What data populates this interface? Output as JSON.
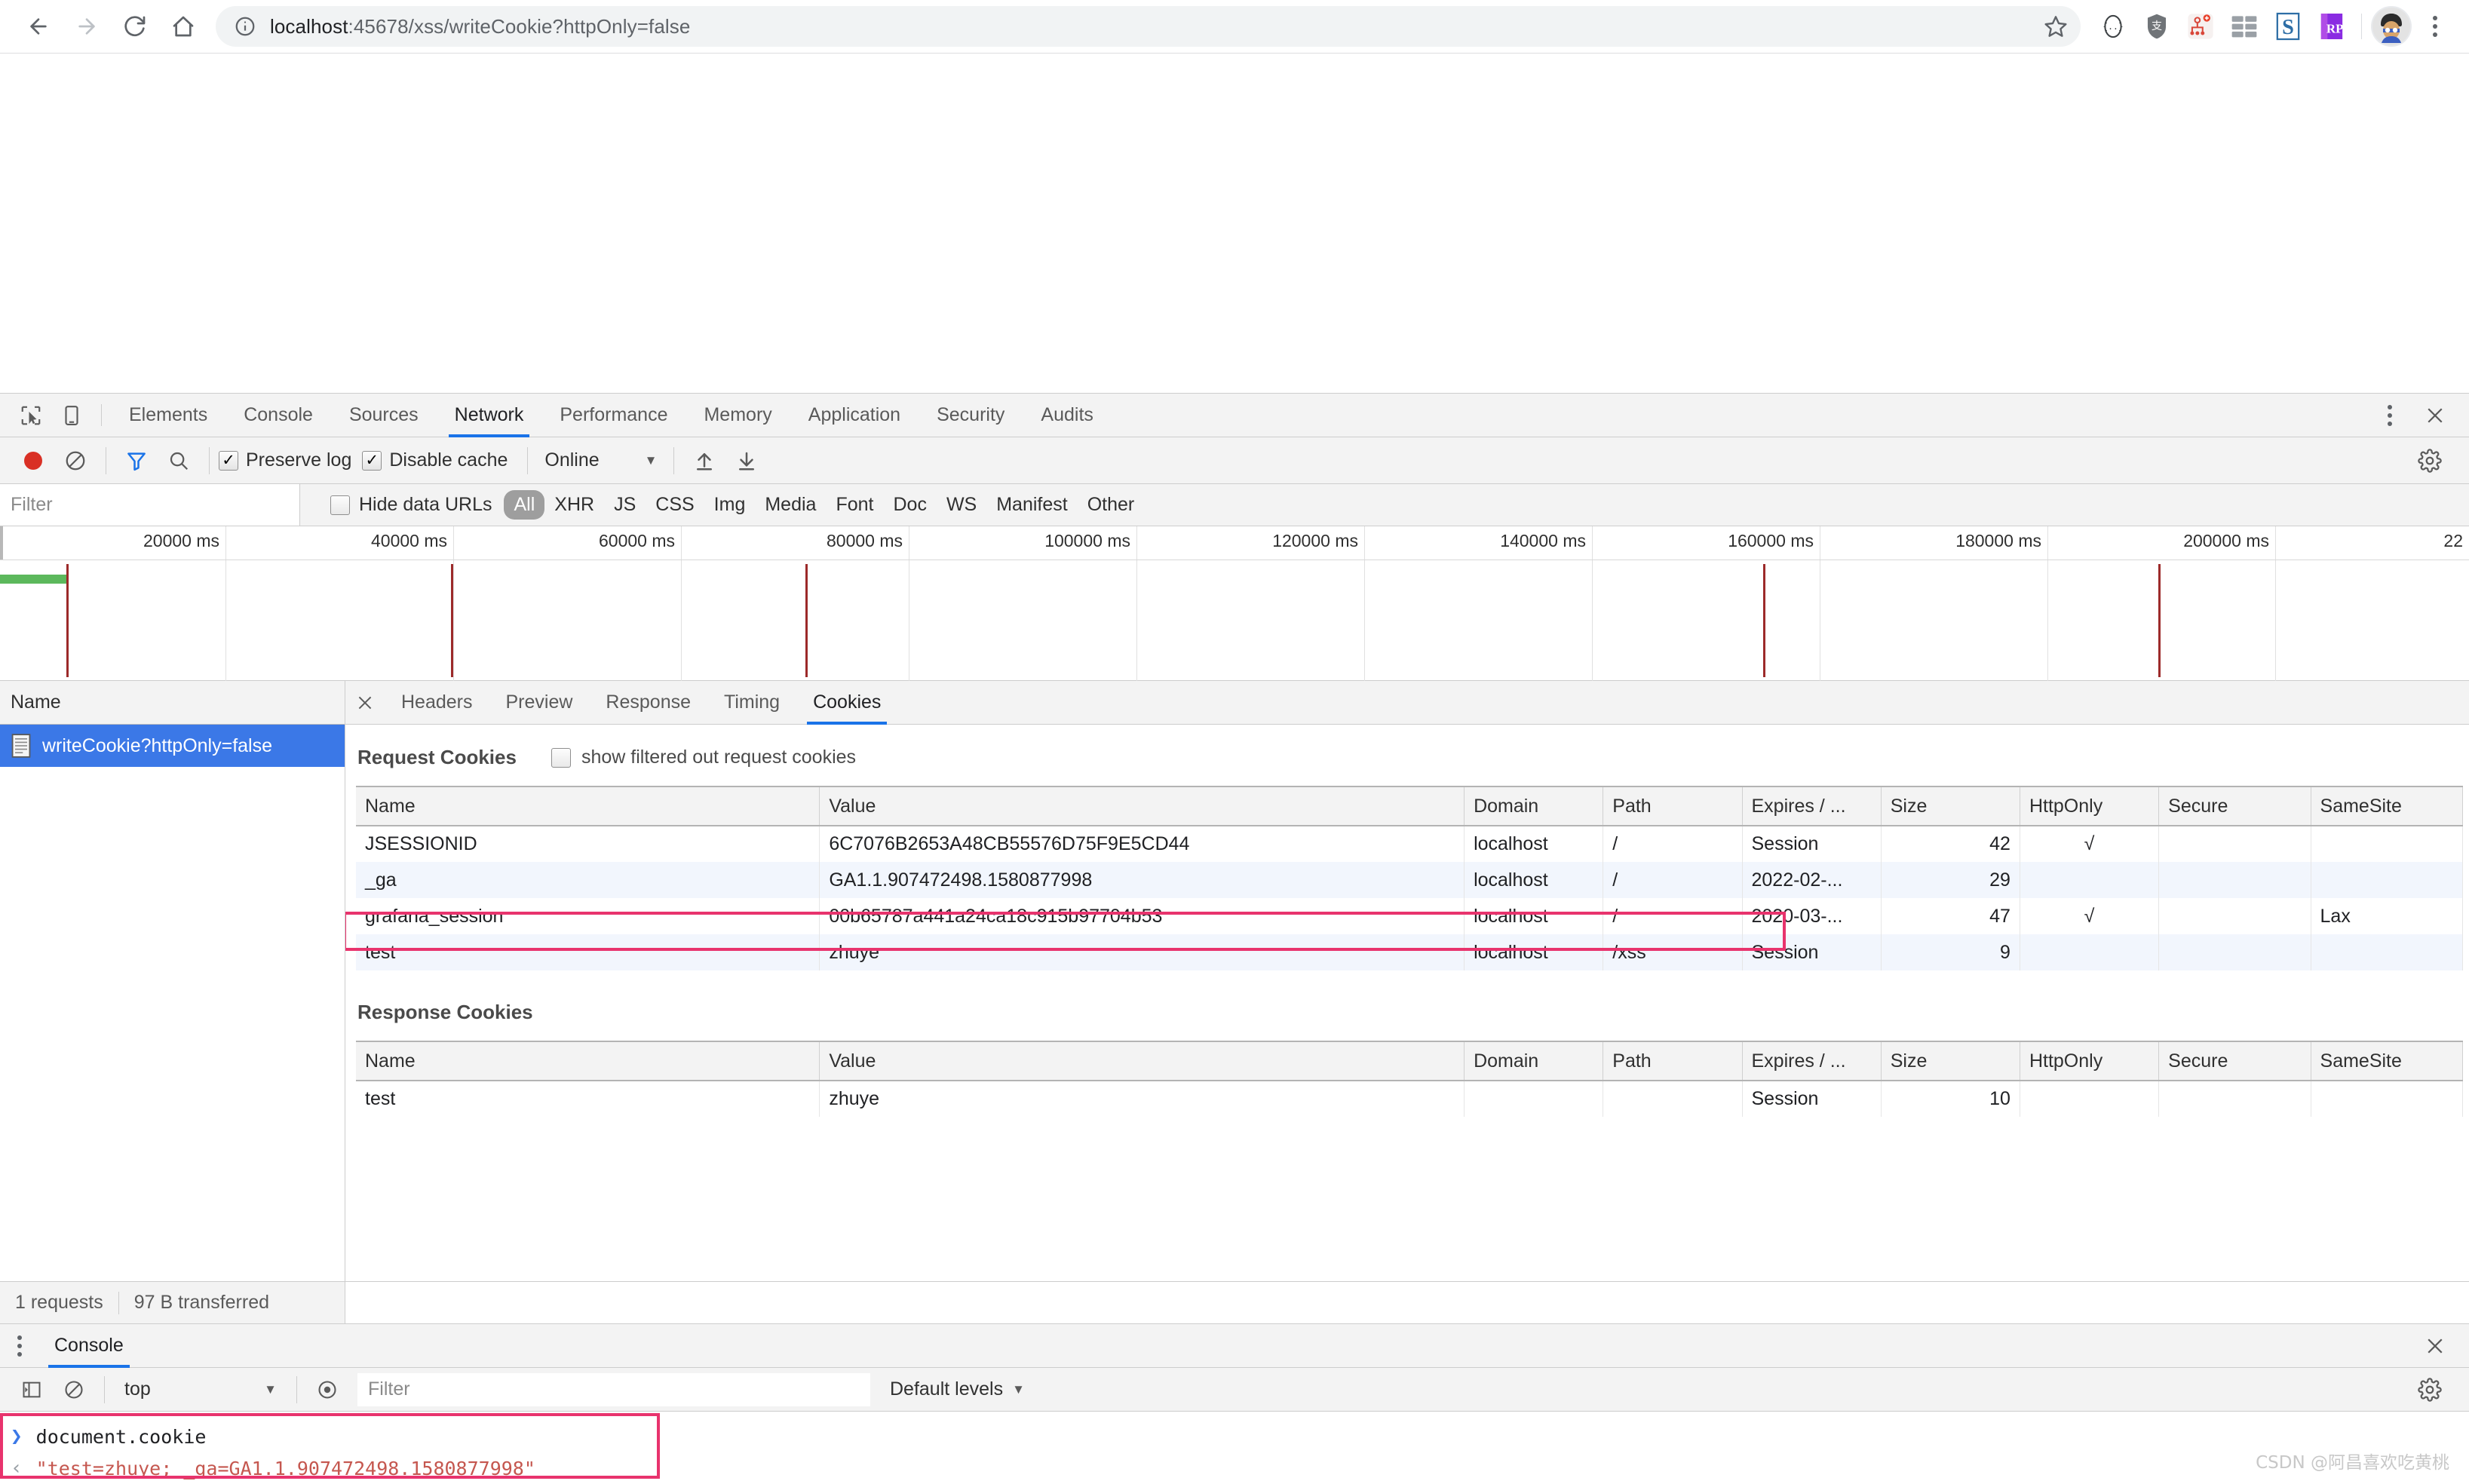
{
  "browser": {
    "url_host": "localhost",
    "url_rest": ":45678/xss/writeCookie?httpOnly=false",
    "back_icon": "back-arrow-icon",
    "forward_icon": "forward-arrow-icon",
    "reload_icon": "reload-icon",
    "home_icon": "home-icon",
    "info_icon": "page-info-icon",
    "star_icon": "bookmark-star-icon",
    "extensions": [
      "json-viewer-icon",
      "alipay-shield-icon",
      "sitemap-icon",
      "grid-layout-icon",
      "s-extension-icon",
      "rp-extension-icon"
    ],
    "avatar": "profile-avatar",
    "menu_icon": "chrome-menu-icon"
  },
  "devtools": {
    "inspect_icon": "inspect-element-icon",
    "device_icon": "device-toolbar-icon",
    "tabs": [
      {
        "label": "Elements",
        "active": false
      },
      {
        "label": "Console",
        "active": false
      },
      {
        "label": "Sources",
        "active": false
      },
      {
        "label": "Network",
        "active": true
      },
      {
        "label": "Performance",
        "active": false
      },
      {
        "label": "Memory",
        "active": false
      },
      {
        "label": "Application",
        "active": false
      },
      {
        "label": "Security",
        "active": false
      },
      {
        "label": "Audits",
        "active": false
      }
    ],
    "more_icon": "devtools-more-icon",
    "close_icon": "devtools-close-icon"
  },
  "network_toolbar": {
    "record_icon": "record-stop-icon",
    "clear_icon": "clear-icon",
    "filter_icon": "funnel-filter-icon",
    "search_icon": "search-icon",
    "preserve_log": {
      "label": "Preserve log",
      "checked": true
    },
    "disable_cache": {
      "label": "Disable cache",
      "checked": true
    },
    "throttle": {
      "value": "Online"
    },
    "import_icon": "import-har-icon",
    "export_icon": "export-har-icon",
    "settings_icon": "network-settings-gear-icon"
  },
  "filter_bar": {
    "placeholder": "Filter",
    "value": "",
    "hide_data_urls": {
      "label": "Hide data URLs",
      "checked": false
    },
    "types": [
      {
        "label": "All",
        "active": true
      },
      {
        "label": "XHR",
        "active": false
      },
      {
        "label": "JS",
        "active": false
      },
      {
        "label": "CSS",
        "active": false
      },
      {
        "label": "Img",
        "active": false
      },
      {
        "label": "Media",
        "active": false
      },
      {
        "label": "Font",
        "active": false
      },
      {
        "label": "Doc",
        "active": false
      },
      {
        "label": "WS",
        "active": false
      },
      {
        "label": "Manifest",
        "active": false
      },
      {
        "label": "Other",
        "active": false
      }
    ]
  },
  "overview": {
    "ticks": [
      "20000 ms",
      "40000 ms",
      "60000 ms",
      "80000 ms",
      "100000 ms",
      "120000 ms",
      "140000 ms",
      "160000 ms",
      "180000 ms",
      "200000 ms",
      "22"
    ]
  },
  "requests": {
    "column_header": "Name",
    "rows": [
      {
        "name": "writeCookie?httpOnly=false",
        "icon": "document-file-icon",
        "selected": true
      }
    ]
  },
  "detail": {
    "close_icon": "detail-close-icon",
    "tabs": [
      {
        "label": "Headers",
        "active": false
      },
      {
        "label": "Preview",
        "active": false
      },
      {
        "label": "Response",
        "active": false
      },
      {
        "label": "Timing",
        "active": false
      },
      {
        "label": "Cookies",
        "active": true
      }
    ]
  },
  "request_cookies": {
    "title": "Request Cookies",
    "show_filtered_label": "show filtered out request cookies",
    "show_filtered_checked": false,
    "columns": [
      "Name",
      "Value",
      "Domain",
      "Path",
      "Expires / ...",
      "Size",
      "HttpOnly",
      "Secure",
      "SameSite"
    ],
    "rows": [
      {
        "name": "JSESSIONID",
        "value": "6C7076B2653A48CB55576D75F9E5CD44",
        "domain": "localhost",
        "path": "/",
        "expires": "Session",
        "size": "42",
        "httponly": "√",
        "secure": "",
        "samesite": ""
      },
      {
        "name": "_ga",
        "value": "GA1.1.907472498.1580877998",
        "domain": "localhost",
        "path": "/",
        "expires": "2022-02-...",
        "size": "29",
        "httponly": "",
        "secure": "",
        "samesite": ""
      },
      {
        "name": "grafana_session",
        "value": "00b65787a441a24ca18c915b97704b53",
        "domain": "localhost",
        "path": "/",
        "expires": "2020-03-...",
        "size": "47",
        "httponly": "√",
        "secure": "",
        "samesite": "Lax"
      },
      {
        "name": "test",
        "value": "zhuye",
        "domain": "localhost",
        "path": "/xss",
        "expires": "Session",
        "size": "9",
        "httponly": "",
        "secure": "",
        "samesite": ""
      }
    ]
  },
  "response_cookies": {
    "title": "Response Cookies",
    "columns": [
      "Name",
      "Value",
      "Domain",
      "Path",
      "Expires / ...",
      "Size",
      "HttpOnly",
      "Secure",
      "SameSite"
    ],
    "rows": [
      {
        "name": "test",
        "value": "zhuye",
        "domain": "",
        "path": "",
        "expires": "Session",
        "size": "10",
        "httponly": "",
        "secure": "",
        "samesite": ""
      }
    ]
  },
  "network_status": {
    "requests": "1 requests",
    "transferred": "97 B transferred"
  },
  "drawer": {
    "kebab_icon": "drawer-menu-icon",
    "tabs": [
      {
        "label": "Console",
        "active": true
      }
    ],
    "close_icon": "drawer-close-icon"
  },
  "console_toolbar": {
    "sidebar_icon": "console-sidebar-icon",
    "clear_icon": "console-clear-icon",
    "context": "top",
    "eye_icon": "live-expression-eye-icon",
    "filter_placeholder": "Filter",
    "filter_value": "",
    "levels": "Default levels",
    "settings_icon": "console-settings-gear-icon"
  },
  "console_output": {
    "input_prompt": "❯",
    "input_text": "document.cookie",
    "output_prompt": "‹",
    "output_text": "\"test=zhuye; _ga=GA1.1.907472498.1580877998\""
  },
  "watermark": "CSDN @阿昌喜欢吃黄桃",
  "colors": {
    "accent_blue": "#1a73e8",
    "selection_blue": "#3b78e7",
    "highlight_pink": "#e8336d",
    "record_red": "#d93025",
    "timeline_marker": "#9c2a2a",
    "timeline_green": "#5cb85c"
  }
}
